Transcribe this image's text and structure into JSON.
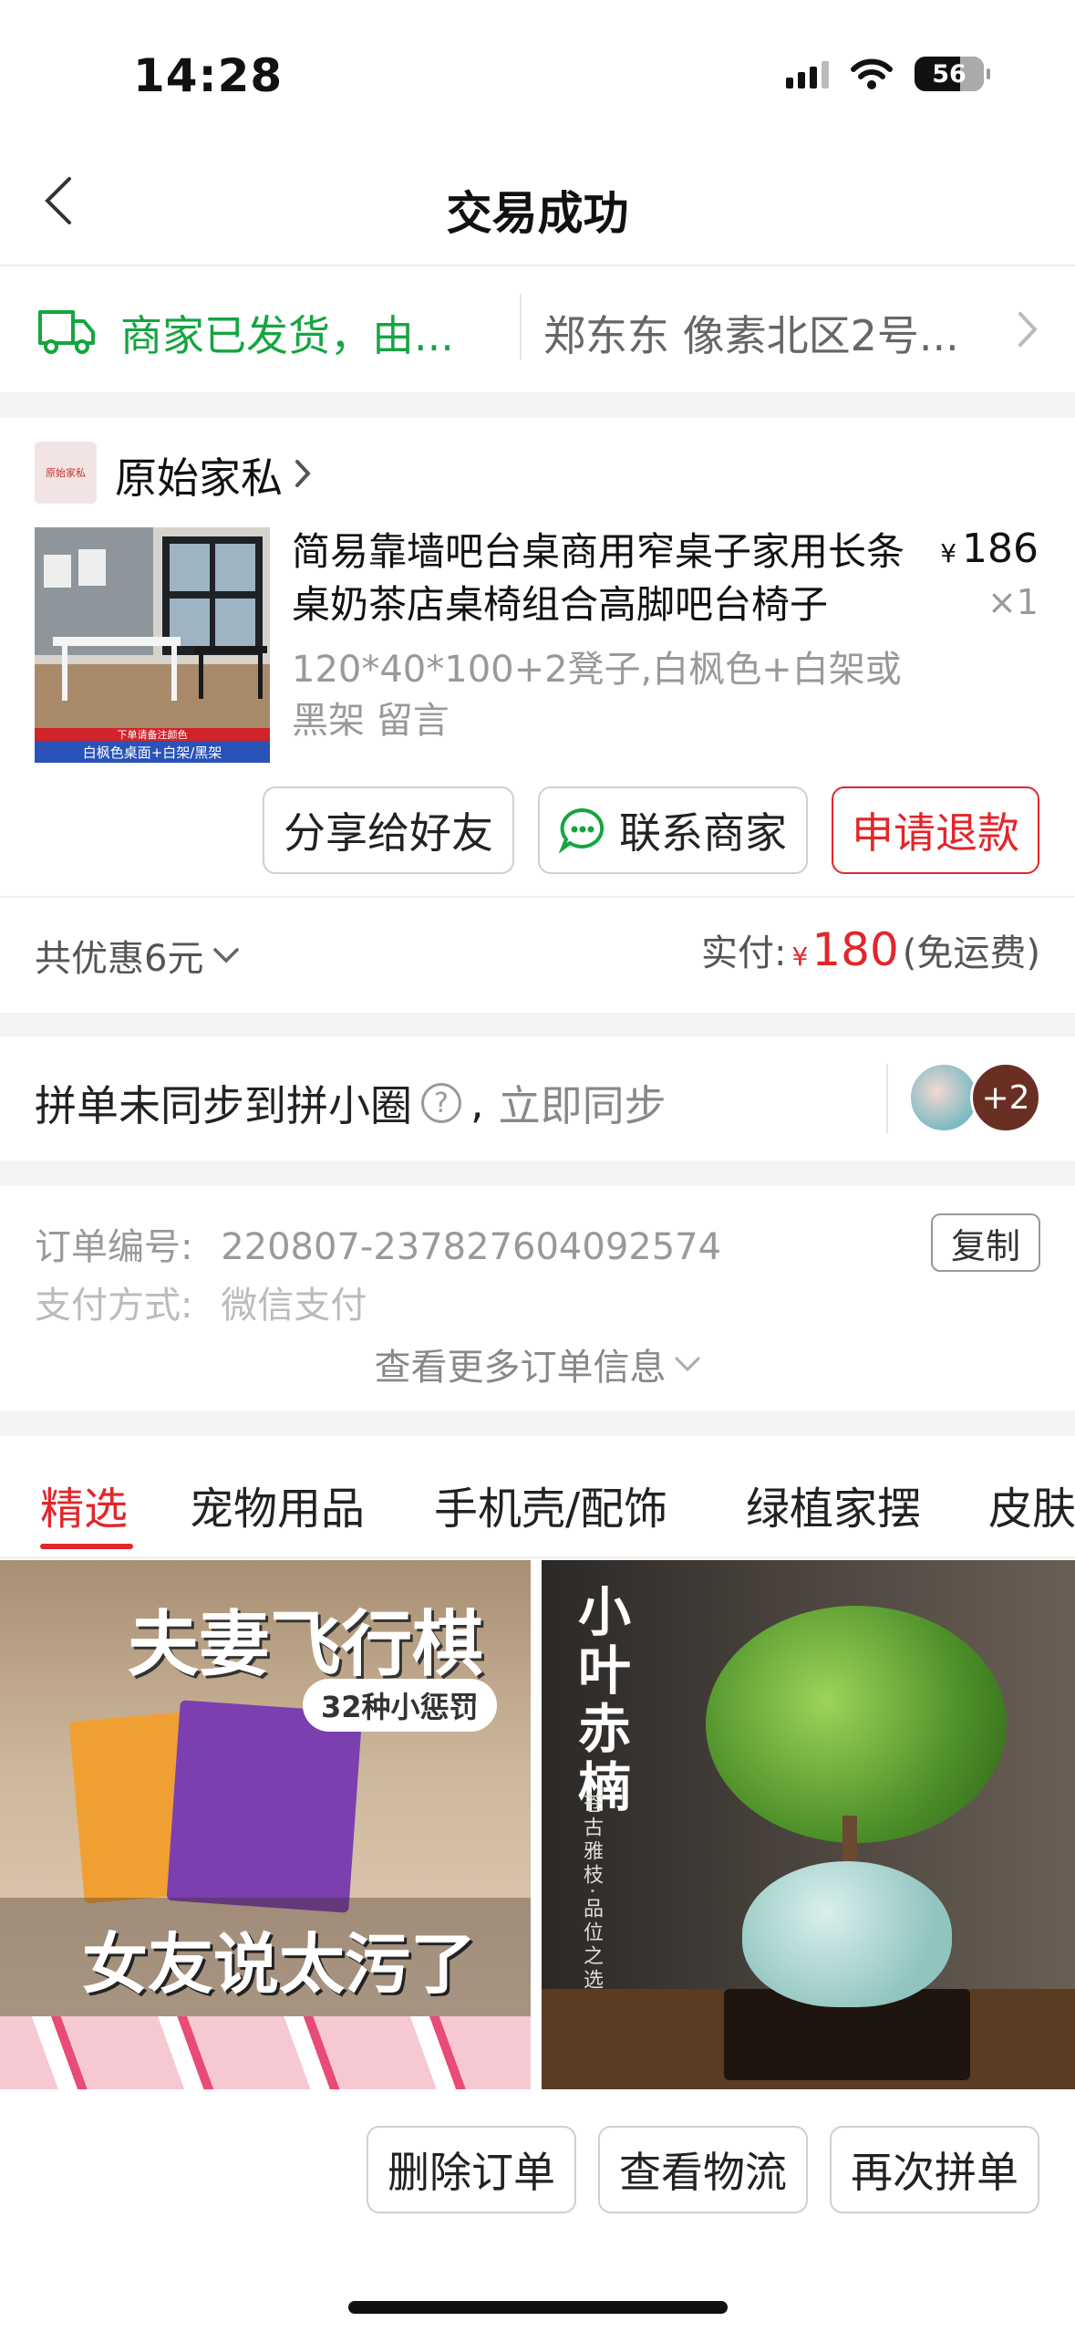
{
  "status_bar": {
    "time": "14:28",
    "battery": "56",
    "icons": [
      "signal-icon",
      "wifi-icon",
      "battery-icon"
    ]
  },
  "nav": {
    "title": "交易成功",
    "back_icon": "chevron-left-icon"
  },
  "logistics": {
    "status": "商家已发货，由...",
    "address": "郑东东 像素北区2号...",
    "icon": "truck-icon"
  },
  "order": {
    "shop_name": "原始家私",
    "shop_logo_text": "原始家私",
    "product_title": "简易靠墙吧台桌商用窄桌子家用长条桌奶茶店桌椅组合高脚吧台椅子",
    "price_symbol": "¥",
    "price": "186",
    "quantity": "×1",
    "spec": "120*40*100+2凳子,白枫色+白架或黑架 留言",
    "thumb_caption_top": "下单请备注颜色",
    "thumb_caption": "白枫色桌面+白架/黑架",
    "buttons": {
      "share": "分享给好友",
      "contact": "联系商家",
      "refund": "申请退款"
    },
    "discount": "共优惠6元",
    "paid_label": "实付:",
    "paid_currency": "¥",
    "paid_amount": "180",
    "shipping_note": "(免运费)"
  },
  "sync": {
    "text": "拼单未同步到拼小圈",
    "help": "?",
    "separator": ",",
    "link": "立即同步",
    "avatar_count": "+2"
  },
  "info": {
    "order_no_label": "订单编号:",
    "order_no": "220807-237827604092574",
    "copy_label": "复制",
    "pay_label": "支付方式:",
    "pay_value": "微信支付",
    "more_label": "查看更多订单信息"
  },
  "tabs": [
    {
      "label": "精选",
      "active": true
    },
    {
      "label": "宠物用品",
      "active": false
    },
    {
      "label": "手机壳/配饰",
      "active": false
    },
    {
      "label": "绿植家摆",
      "active": false
    },
    {
      "label": "皮肤",
      "active": false
    }
  ],
  "feed": {
    "left": {
      "title": "夫妻飞行棋",
      "badge": "32种小惩罚",
      "caption": "女友说太污了"
    },
    "right": {
      "title": "小叶赤楠",
      "subtitle": "苍古雅枝·品位之选"
    }
  },
  "bottom_buttons": {
    "delete": "删除订单",
    "logistics": "查看物流",
    "reorder": "再次拼单"
  },
  "colors": {
    "accent_red": "#e2262b",
    "ship_green": "#15a540"
  }
}
